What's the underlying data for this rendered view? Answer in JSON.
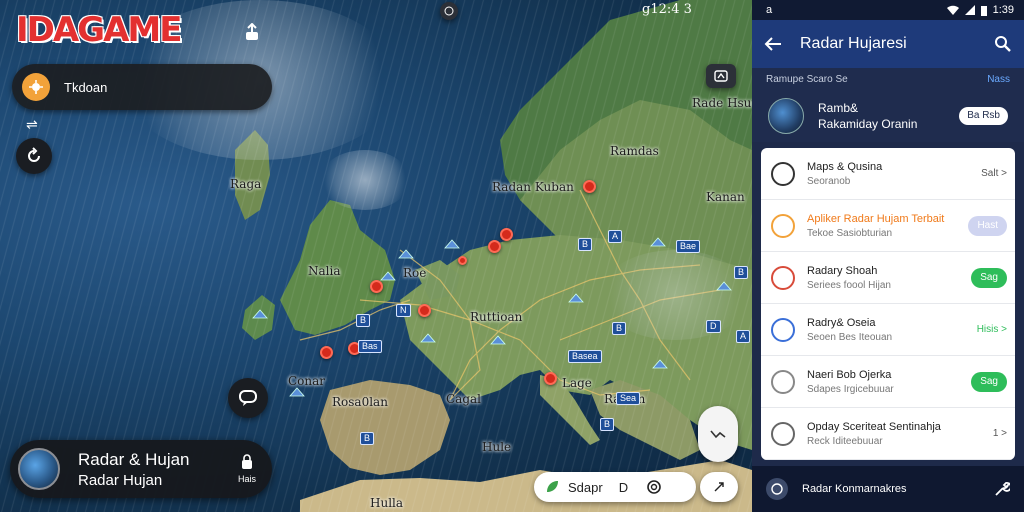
{
  "map": {
    "logo_text": "IDAGAME",
    "status_right": "g12:4 3",
    "location_label": "Tkdoan",
    "sidebar_toggle_glyph": "⇌",
    "labels": {
      "top_right": "Rade Hsuuan",
      "left_island": "Raga",
      "scandinavia": "Ramdas",
      "radar_label": "Radan Kuban",
      "east": "Kanan",
      "uk": "Nalia",
      "uk_east": "Roe",
      "central": "Ruttioan",
      "paris": "Cagal",
      "iberia": "Rosa0lan",
      "adriatic": "Lage",
      "balkan": "Raslan",
      "iberia_west": "Conar",
      "africa_a": "Hule",
      "africa_b": "Hulla"
    },
    "road_badges": [
      "B",
      "A",
      "B",
      "B",
      "N",
      "B",
      "D",
      "Basea",
      "B",
      "B",
      "Bae",
      "Bas",
      "A",
      "Sea"
    ],
    "bottom_card": {
      "title": "Radar & Hujan",
      "subtitle": "Radar Hujan",
      "tag": "Hais"
    },
    "search": {
      "text": "Sdapr",
      "suffix": "D"
    },
    "colors": {
      "pin": "#d42a1c",
      "logo": "#e33030"
    }
  },
  "panel": {
    "status": {
      "left": "a",
      "time": "1:39"
    },
    "appbar": {
      "title": "Radar Hujaresi"
    },
    "subheader": {
      "left": "Ramupe  Scaro Se",
      "right": "Nass"
    },
    "user": {
      "title": "Ramb&",
      "subtitle": "Rakamiday Oranin",
      "pill": "Ba Rsb"
    },
    "list": [
      {
        "title": "Maps & Qusina",
        "subtitle": "Seoranob",
        "action": "Salt >",
        "action_type": "text",
        "title_color": "#222222"
      },
      {
        "title": "Apliker Radar Hujam Terbait",
        "subtitle": "Tekoe Sasiobturian",
        "action": "Hast",
        "action_type": "grey",
        "title_color": "#f07a1a"
      },
      {
        "title": "Radary Shoah",
        "subtitle": "Seriees foool Hijan",
        "action": "Sag",
        "action_type": "green",
        "title_color": "#222222"
      },
      {
        "title": "Radry& Oseia",
        "subtitle": "Seoen Bes Iteouan",
        "action": "Hisis >",
        "action_type": "green-text",
        "title_color": "#222222"
      },
      {
        "title": "Naeri Bob Ojerka",
        "subtitle": "Sdapes Irgicebuuar",
        "action": "Sag",
        "action_type": "green",
        "title_color": "#222222"
      },
      {
        "title": "Opday Sceriteat Sentinahja",
        "subtitle": "Reck Iditeebuuar",
        "action": "1 >",
        "action_type": "text",
        "title_color": "#222222"
      }
    ],
    "footer": {
      "text": "Radar Konmarnakres"
    },
    "colors": {
      "appbar": "#1e3a7a",
      "panel_bg": "#1e2a4a",
      "accent_green": "#2ebd5a",
      "link": "#6aa9ff"
    }
  }
}
